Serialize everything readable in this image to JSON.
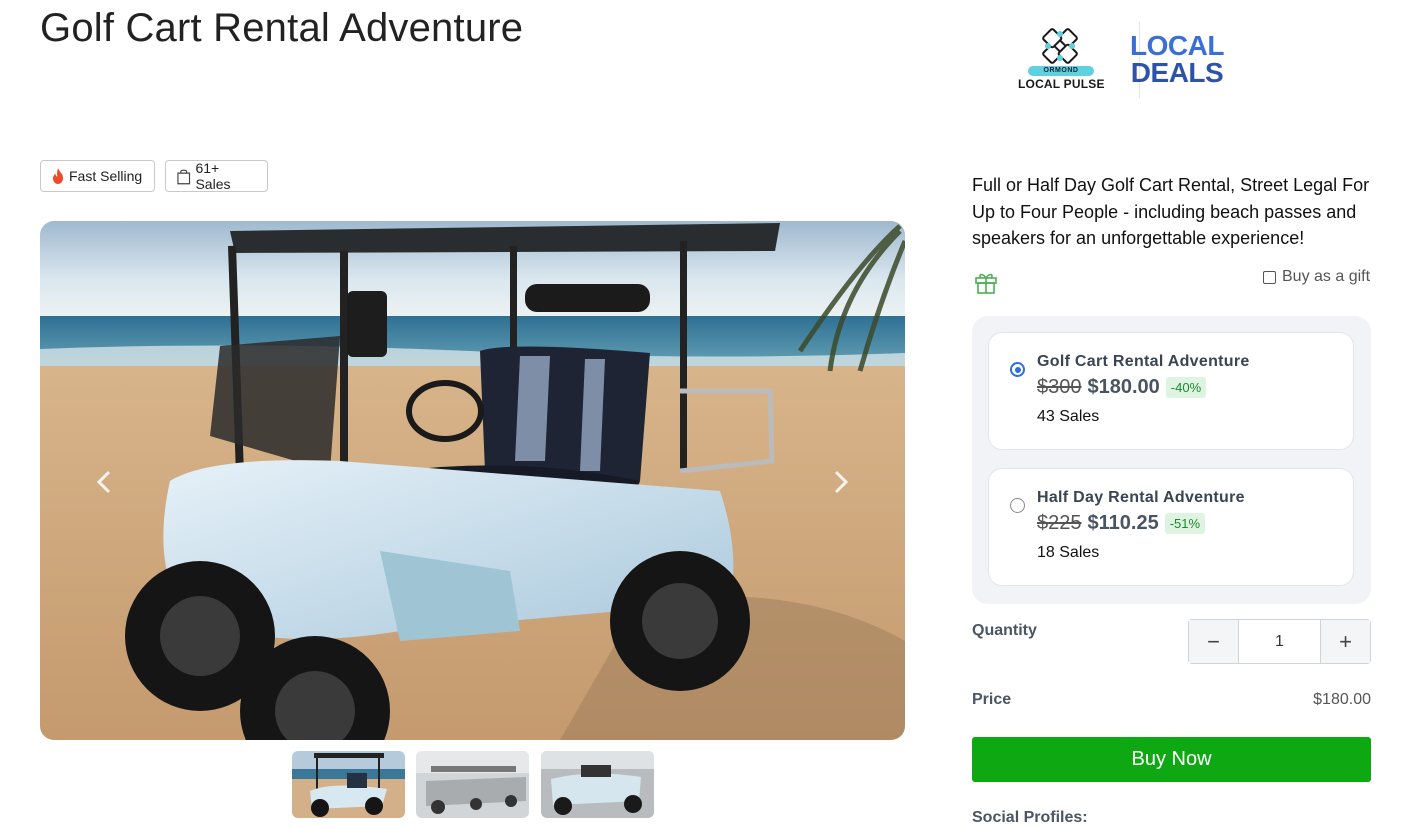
{
  "page": {
    "title": "Golf Cart Rental Adventure"
  },
  "logos": {
    "local_pulse_top": "ORMOND",
    "local_pulse_bottom": "LOCAL PULSE",
    "local_deals_line1": "LOCAL",
    "local_deals_line2": "DEALS"
  },
  "badges": {
    "fast_selling": "Fast Selling",
    "sales": "61+ Sales"
  },
  "gallery": {
    "thumbnails": [
      "thumb-1",
      "thumb-2",
      "thumb-3"
    ]
  },
  "description": "Full or Half Day Golf Cart Rental, Street Legal For Up to Four People - including beach passes and speakers for an unforgettable experience!",
  "gift": {
    "label": "Buy as a gift",
    "checked": false
  },
  "options": [
    {
      "title": "Golf Cart Rental Adventure",
      "old_price": "$300",
      "new_price": "$180.00",
      "discount": "-40%",
      "sales": "43 Sales",
      "selected": true
    },
    {
      "title": "Half Day Rental Adventure",
      "old_price": "$225",
      "new_price": "$110.25",
      "discount": "-51%",
      "sales": "18 Sales",
      "selected": false
    }
  ],
  "quantity": {
    "label": "Quantity",
    "value": "1",
    "decrement": "−",
    "increment": "+"
  },
  "price": {
    "label": "Price",
    "value": "$180.00"
  },
  "buy_button": "Buy Now",
  "social_label": "Social Profiles:",
  "colors": {
    "buy_green": "#0ea813",
    "radio_blue": "#2e6ee0",
    "discount_green": "#1c8a2f"
  }
}
